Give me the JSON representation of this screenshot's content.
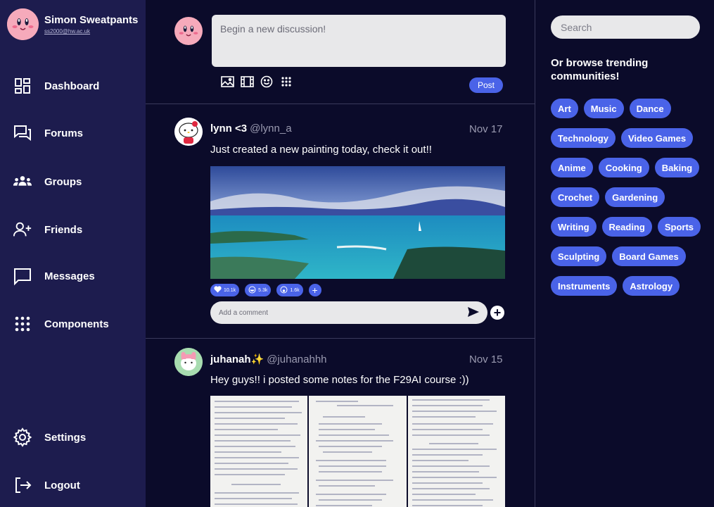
{
  "user": {
    "name": "Simon Sweatpants",
    "email": "ss2000@hw.ac.uk",
    "avatar_icon": "kirby-avatar"
  },
  "nav": {
    "items": [
      {
        "label": "Dashboard",
        "icon": "dashboard-icon"
      },
      {
        "label": "Forums",
        "icon": "forums-icon"
      },
      {
        "label": "Groups",
        "icon": "groups-icon"
      },
      {
        "label": "Friends",
        "icon": "friends-icon"
      },
      {
        "label": "Messages",
        "icon": "messages-icon"
      },
      {
        "label": "Components",
        "icon": "components-icon"
      }
    ],
    "bottom": [
      {
        "label": "Settings",
        "icon": "gear-icon"
      },
      {
        "label": "Logout",
        "icon": "logout-icon"
      }
    ]
  },
  "composer": {
    "placeholder": "Begin a new discussion!",
    "tools": [
      "image-icon",
      "video-icon",
      "emoji-icon",
      "grid-icon"
    ],
    "post_label": "Post"
  },
  "posts": [
    {
      "name": "lynn <3",
      "handle": "@lynn_a",
      "date": "Nov 17",
      "text": "Just created a new painting today, check it out!!",
      "reactions": [
        {
          "icon": "heart-icon",
          "count": "10.1k"
        },
        {
          "icon": "laugh-icon",
          "count": "5.3k"
        },
        {
          "icon": "wow-icon",
          "count": "1.6k"
        }
      ],
      "comment_placeholder": "Add a comment"
    },
    {
      "name": "juhanah",
      "name_emoji": "✨",
      "handle": "@juhanahhh",
      "date": "Nov 15",
      "text": "Hey guys!! i posted some notes for the F29AI course :))"
    }
  ],
  "right": {
    "search_placeholder": "Search",
    "browse_title": "Or browse trending communities!",
    "tags": [
      "Art",
      "Music",
      "Dance",
      "Technology",
      "Video Games",
      "Anime",
      "Cooking",
      "Baking",
      "Crochet",
      "Gardening",
      "Writing",
      "Reading",
      "Sports",
      "Sculpting",
      "Board Games",
      "Instruments",
      "Astrology"
    ]
  },
  "colors": {
    "sidebar": "#1d1c4e",
    "background": "#0b0b2a",
    "accent": "#4a63e8"
  }
}
